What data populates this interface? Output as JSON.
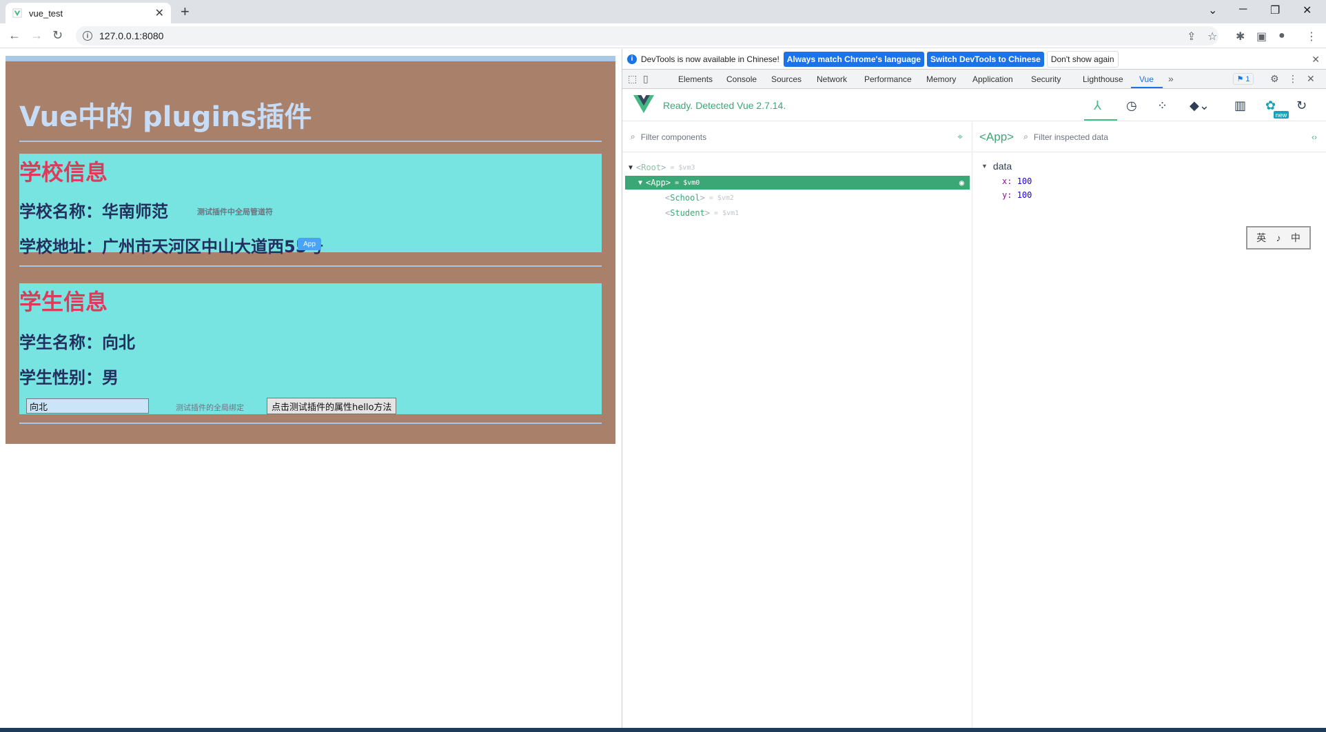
{
  "browser": {
    "tab_title": "vue_test",
    "tab_close": "✕",
    "new_tab": "+",
    "url": "127.0.0.1:8080",
    "window_controls": [
      "⌄",
      "─",
      "❐",
      "✕"
    ]
  },
  "page": {
    "title": "Vue中的 plugins插件",
    "school": {
      "heading": "学校信息",
      "name_label": "学校名称：华南师范",
      "global_filter_note": "测试插件中全局管道符",
      "address_label": "学校地址：广州市天河区中山大道西55号",
      "app_tag": "App"
    },
    "student": {
      "heading": "学生信息",
      "name_label": "学生名称：向北",
      "gender_label": "学生性别：男",
      "input_value": "向北",
      "global_bind_note": "测试插件的全局绑定",
      "hello_button": "点击测试插件的属性hello方法"
    }
  },
  "devtools": {
    "info": {
      "message": "DevTools is now available in Chinese!",
      "btn_match": "Always match Chrome's language",
      "btn_switch": "Switch DevTools to Chinese",
      "btn_dismiss": "Don't show again"
    },
    "tabs": [
      "Elements",
      "Console",
      "Sources",
      "Network",
      "Performance",
      "Memory",
      "Application",
      "Security",
      "Lighthouse",
      "Vue"
    ],
    "more_tabs": "»",
    "issues_count": "1",
    "vue_status": "Ready. Detected Vue 2.7.14.",
    "new_badge": "new",
    "filter_components_placeholder": "Filter components",
    "filter_data_placeholder": "Filter inspected data",
    "inspected_component": "<App>",
    "tree": [
      {
        "name": "Root",
        "vm": "= $vm3"
      },
      {
        "name": "App",
        "vm": "= $vm0"
      },
      {
        "name": "School",
        "vm": "= $vm2"
      },
      {
        "name": "Student",
        "vm": "= $vm1"
      }
    ],
    "data_section": "data",
    "data_fields": [
      {
        "key": "x:",
        "value": "100"
      },
      {
        "key": "y:",
        "value": "100"
      }
    ],
    "ime_chars": [
      "英",
      "♪",
      "中"
    ],
    "colors": {
      "vue_green": "#3ba776",
      "accent_blue": "#1a73e8"
    }
  }
}
